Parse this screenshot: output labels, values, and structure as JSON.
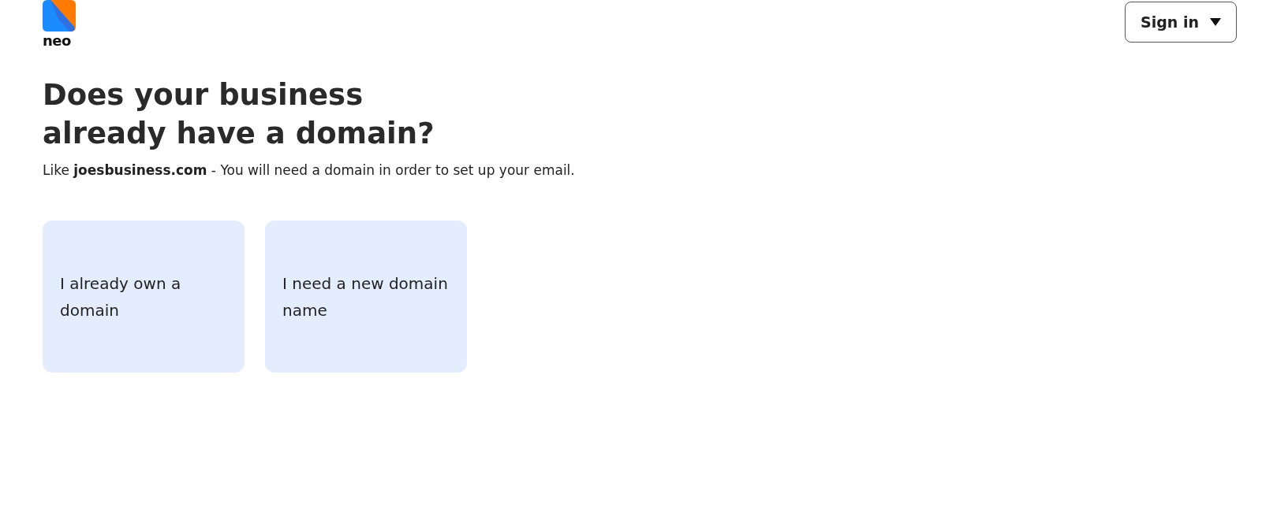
{
  "logo": {
    "text": "neo"
  },
  "sign_in": {
    "label": "Sign in"
  },
  "heading": "Does your business already have a domain?",
  "subtitle": "Like **joesbusiness.com** - You will need a domain in order to set up your email.",
  "options": [
    {
      "label": "I already own a domain"
    },
    {
      "label": "I need a new domain name"
    }
  ]
}
